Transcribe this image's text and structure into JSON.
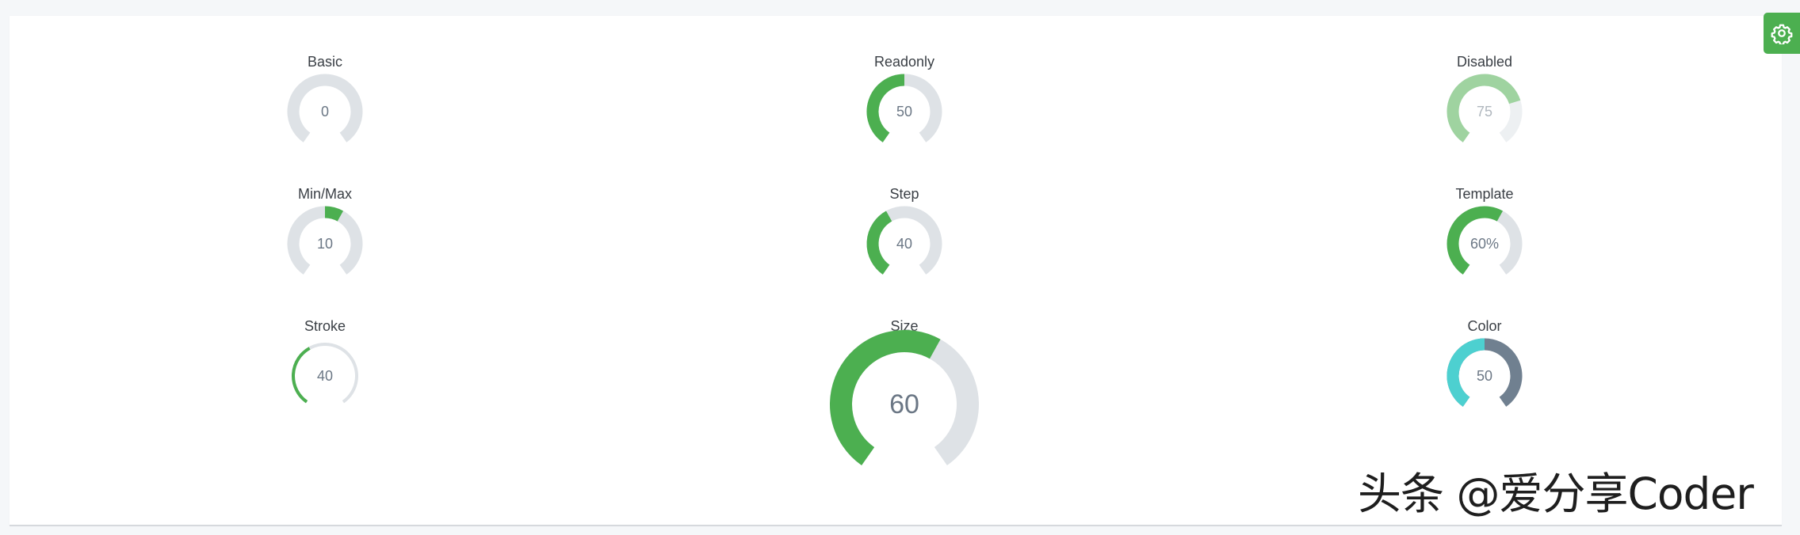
{
  "knobs": [
    {
      "title": "Basic",
      "value": 0,
      "display": "0",
      "min": 0,
      "max": 100,
      "state": "normal"
    },
    {
      "title": "Readonly",
      "value": 50,
      "display": "50",
      "min": 0,
      "max": 100,
      "state": "readonly"
    },
    {
      "title": "Disabled",
      "value": 75,
      "display": "75",
      "min": 0,
      "max": 100,
      "state": "disabled"
    },
    {
      "title": "Min/Max",
      "value": 10,
      "display": "10",
      "min": -50,
      "max": 50,
      "state": "normal"
    },
    {
      "title": "Step",
      "value": 40,
      "display": "40",
      "min": 0,
      "max": 100,
      "state": "normal"
    },
    {
      "title": "Template",
      "value": 60,
      "display": "60%",
      "min": 0,
      "max": 100,
      "state": "normal"
    },
    {
      "title": "Stroke",
      "value": 40,
      "display": "40",
      "min": 0,
      "max": 100,
      "state": "normal"
    },
    {
      "title": "Size",
      "value": 60,
      "display": "60",
      "min": 0,
      "max": 100,
      "state": "normal"
    },
    {
      "title": "Color",
      "value": 50,
      "display": "50",
      "min": 0,
      "max": 100,
      "state": "normal"
    }
  ],
  "colors": {
    "value": "#4caf50",
    "range": "#dee2e6",
    "text": "#6b7785",
    "disabled_value": "#9fd3a0",
    "disabled_range": "#edf0f2",
    "disabled_text": "#b0b7be",
    "color_knob_value": "#4dd0d0",
    "color_knob_range": "#708090"
  },
  "settings": {
    "icon": "gear-icon"
  },
  "watermark": {
    "text": "头条 @爱分享Coder"
  }
}
